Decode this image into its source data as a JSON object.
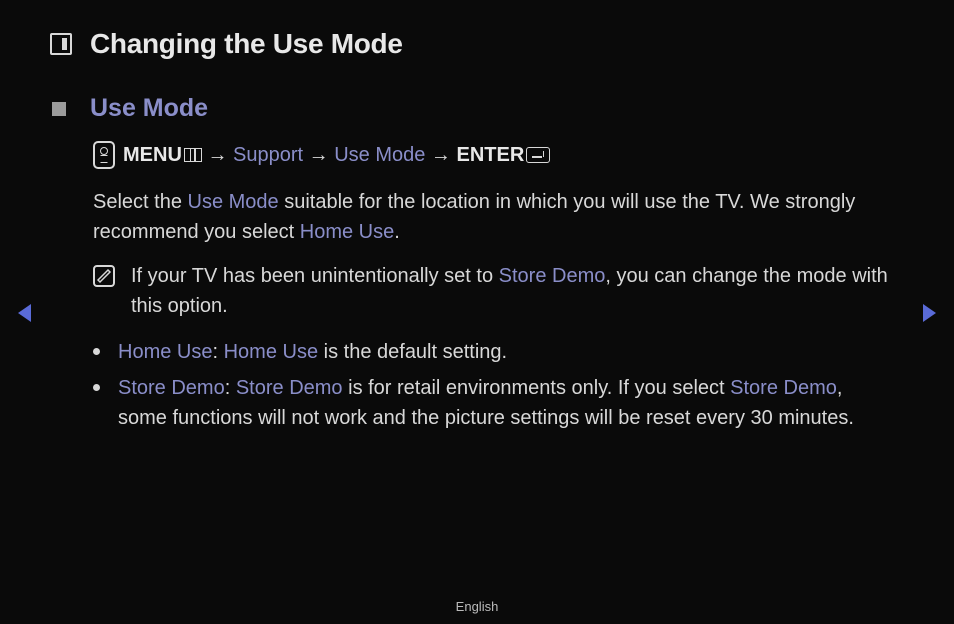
{
  "page": {
    "title": "Changing the Use Mode"
  },
  "section": {
    "heading": "Use Mode"
  },
  "menu_path": {
    "menu": "MENU",
    "arrow": "→",
    "support": "Support",
    "use_mode": "Use Mode",
    "enter": "ENTER"
  },
  "body": {
    "p1_a": "Select the ",
    "p1_link1": "Use Mode",
    "p1_b": " suitable for the location in which you will use the TV. We strongly recommend you select ",
    "p1_link2": "Home Use",
    "p1_c": "."
  },
  "note": {
    "a": "If your TV has been unintentionally set to ",
    "link": "Store Demo",
    "b": ", you can change the mode with this option."
  },
  "bullets": {
    "home": {
      "link1": "Home Use",
      "colon": ": ",
      "link2": "Home Use",
      "rest": " is the default setting."
    },
    "store": {
      "link1": "Store Demo",
      "colon": ": ",
      "link2": "Store Demo",
      "mid": " is for retail environments only. If you select ",
      "link3": "Store Demo",
      "rest": ", some functions will not work and the picture settings will be reset every 30 minutes."
    }
  },
  "footer": {
    "language": "English"
  }
}
